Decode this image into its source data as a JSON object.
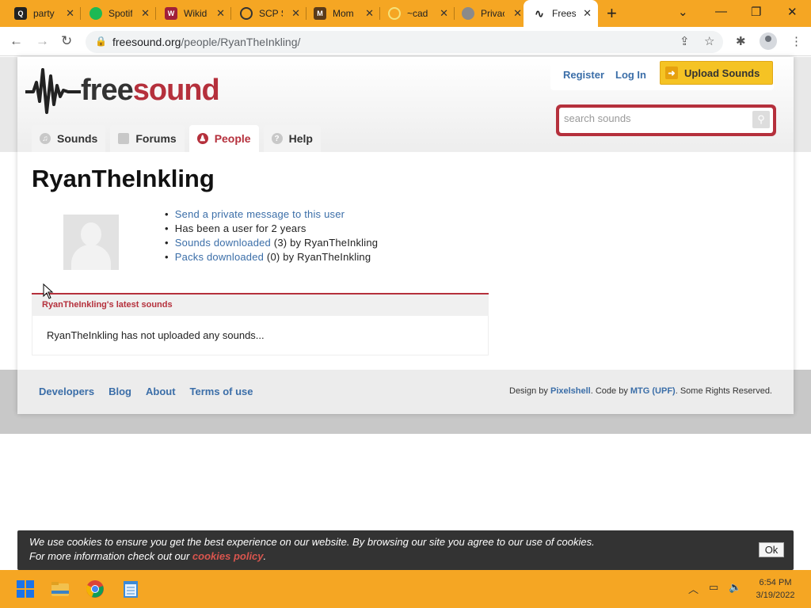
{
  "browser": {
    "tabs": [
      {
        "title": "party",
        "favicon": "quora-icon",
        "color": "#222222"
      },
      {
        "title": "Spotify",
        "favicon": "spotify-icon",
        "color": "#1db954"
      },
      {
        "title": "Wikidot",
        "favicon": "wikidot-icon",
        "color": "#a0203a"
      },
      {
        "title": "SCP S",
        "favicon": "scp-icon",
        "color": "#333333"
      },
      {
        "title": "Mom",
        "favicon": "mom-icon",
        "color": "#5a3b1a"
      },
      {
        "title": "~cad",
        "favicon": "circle-icon",
        "color": "#f5c324"
      },
      {
        "title": "Privacy",
        "favicon": "globe-icon",
        "color": "#8a8a8a"
      },
      {
        "title": "Freesound",
        "favicon": "freesound-icon",
        "color": "#222222",
        "active": true
      }
    ],
    "url_host": "freesound.org",
    "url_path": "/people/RyanTheInkling/"
  },
  "site": {
    "logo_left": "free",
    "logo_right": "sound",
    "register": "Register",
    "login": "Log In",
    "upload": "Upload Sounds",
    "search_placeholder": "search sounds",
    "nav": [
      {
        "label": "Sounds",
        "icon": "headphones-icon"
      },
      {
        "label": "Forums",
        "icon": "speech-bubble-icon"
      },
      {
        "label": "People",
        "icon": "people-icon",
        "active": true
      },
      {
        "label": "Help",
        "icon": "question-icon"
      }
    ],
    "accent": "#b5303c",
    "link_color": "#3b6ea8"
  },
  "profile": {
    "username": "RyanTheInkling",
    "send_message": "Send a private message to this user",
    "member_for": "Has been a user for 2 years",
    "sounds_downloaded_link": "Sounds downloaded",
    "sounds_downloaded_rest": " (3) by RyanTheInkling",
    "packs_downloaded_link": "Packs downloaded",
    "packs_downloaded_rest": " (0) by RyanTheInkling",
    "latest_heading": "RyanTheInkling's latest sounds",
    "latest_empty": "RyanTheInkling has not uploaded any sounds..."
  },
  "footer": {
    "links": [
      "Developers",
      "Blog",
      "About",
      "Terms of use"
    ],
    "credit_design": "Design by ",
    "credit_pixelshell": "Pixelshell",
    "credit_code": ". Code by ",
    "credit_mtg": "MTG (UPF)",
    "credit_rights": ". Some Rights Reserved."
  },
  "cookies": {
    "line1": "We use cookies to ensure you get the best experience on our website. By browsing our site you agree to our use of cookies.",
    "line2_before": "For more information check out our ",
    "line2_link": "cookies policy",
    "line2_after": ".",
    "ok": "Ok"
  },
  "taskbar": {
    "time": "6:54 PM",
    "date": "3/19/2022"
  }
}
